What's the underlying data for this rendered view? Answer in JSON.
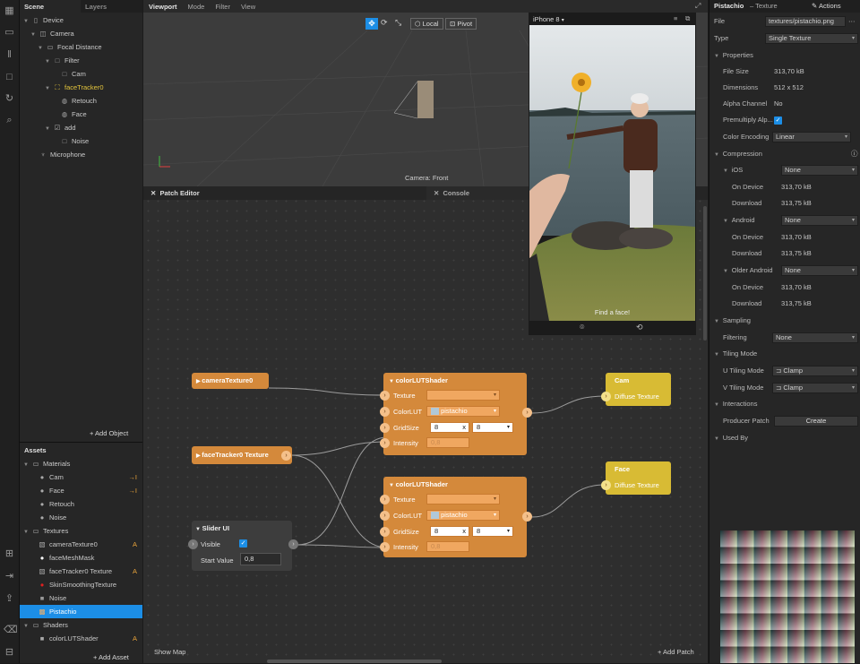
{
  "scene_panel": {
    "tabs": [
      "Scene",
      "Layers"
    ],
    "tree": [
      {
        "label": "Device",
        "icon": "phone-icon"
      },
      {
        "label": "Camera",
        "icon": "camera-icon"
      },
      {
        "label": "Focal Distance",
        "icon": "focal-icon"
      },
      {
        "label": "Filter",
        "icon": "square-icon"
      },
      {
        "label": "Cam",
        "icon": "square-icon"
      },
      {
        "label": "faceTracker0",
        "icon": "face-tracker-icon"
      },
      {
        "label": "Retouch",
        "icon": "sphere-icon"
      },
      {
        "label": "Face",
        "icon": "sphere-icon"
      },
      {
        "label": "add",
        "icon": "square-icon"
      },
      {
        "label": "Noise",
        "icon": "square-icon"
      },
      {
        "label": "Microphone",
        "icon": "microphone-icon"
      }
    ],
    "add_object": "+ Add Object"
  },
  "assets_panel": {
    "title": "Assets",
    "items": [
      {
        "label": "Materials",
        "icon": "folder-icon",
        "badge": ""
      },
      {
        "label": "Cam",
        "icon": "material-icon",
        "badge": "→I"
      },
      {
        "label": "Face",
        "icon": "material-icon",
        "badge": "→I"
      },
      {
        "label": "Retouch",
        "icon": "material-icon",
        "badge": ""
      },
      {
        "label": "Noise",
        "icon": "material-icon",
        "badge": ""
      },
      {
        "label": "Textures",
        "icon": "folder-icon",
        "badge": ""
      },
      {
        "label": "cameraTexture0",
        "icon": "texture-icon",
        "badge": "A"
      },
      {
        "label": "faceMeshMask",
        "icon": "white-circle-icon",
        "badge": ""
      },
      {
        "label": "faceTracker0 Texture",
        "icon": "texture-icon",
        "badge": "A"
      },
      {
        "label": "SkinSmoothingTexture",
        "icon": "red-circle-icon",
        "badge": ""
      },
      {
        "label": "Noise",
        "icon": "gray-square-icon",
        "badge": ""
      },
      {
        "label": "Pistachio",
        "icon": "image-thumb-icon",
        "badge": ""
      },
      {
        "label": "Shaders",
        "icon": "folder-icon",
        "badge": ""
      },
      {
        "label": "colorLUTShader",
        "icon": "shader-icon",
        "badge": "A"
      }
    ],
    "add_asset": "+ Add Asset"
  },
  "viewport": {
    "menu": [
      "Viewport",
      "Mode",
      "Filter",
      "View"
    ],
    "tools": {
      "local": "Local",
      "pivot": "Pivot"
    },
    "camera_label": "Camera: Front"
  },
  "patch_editor": {
    "tab": "Patch Editor",
    "console_tab": "Console",
    "nodes": {
      "camera_texture": "cameraTexture0",
      "face_tracker_texture": "faceTracker0 Texture",
      "shader1": {
        "title": "colorLUTShader",
        "texture": "Texture",
        "colorlut": "ColorLUT",
        "colorlut_value": "pistachio",
        "gridsize": "GridSize",
        "grid_x": "8",
        "grid_y": "8",
        "x_sep": "x",
        "intensity": "Intensity",
        "intensity_value": "0,8"
      },
      "shader2": {
        "title": "colorLUTShader",
        "texture": "Texture",
        "colorlut": "ColorLUT",
        "colorlut_value": "pistachio",
        "gridsize": "GridSize",
        "grid_x": "8",
        "grid_y": "8",
        "x_sep": "x",
        "intensity": "Intensity",
        "intensity_value": "0,8"
      },
      "cam_output": {
        "title": "Cam",
        "port": "Diffuse Texture"
      },
      "face_output": {
        "title": "Face",
        "port": "Diffuse Texture"
      },
      "slider": {
        "title": "Slider UI",
        "visible": "Visible",
        "start_value_label": "Start Value",
        "start_value": "0,8"
      }
    },
    "show_map": "Show Map",
    "add_patch": "+ Add Patch"
  },
  "phone_preview": {
    "device": "iPhone 8",
    "overlay_text": "Find a face!"
  },
  "inspector": {
    "title": "Pistachio",
    "subtitle": "– Texture",
    "actions": "Actions",
    "file_label": "File",
    "file_value": "textures/pistachio.png",
    "type_label": "Type",
    "type_value": "Single Texture",
    "properties": "Properties",
    "file_size_label": "File Size",
    "file_size": "313,70 kB",
    "dimensions_label": "Dimensions",
    "dimensions": "512 x 512",
    "alpha_label": "Alpha Channel",
    "alpha": "No",
    "premultiply_label": "Premultiply Alp...",
    "color_encoding_label": "Color Encoding",
    "color_encoding": "Linear",
    "compression": "Compression",
    "ios": "iOS",
    "android": "Android",
    "older_android": "Older Android",
    "none": "None",
    "on_device_label": "On Device",
    "download_label": "Download",
    "ios_on_device": "313,70 kB",
    "ios_download": "313,75 kB",
    "android_on_device": "313,70 kB",
    "android_download": "313,75 kB",
    "older_on_device": "313,70 kB",
    "older_download": "313,75 kB",
    "sampling": "Sampling",
    "filtering_label": "Filtering",
    "filtering": "None",
    "tiling_mode": "Tiling Mode",
    "u_tiling_label": "U Tiling Mode",
    "v_tiling_label": "V Tiling Mode",
    "clamp": "Clamp",
    "interactions": "Interactions",
    "producer_patch_label": "Producer Patch",
    "create": "Create",
    "used_by": "Used By"
  },
  "colors": {
    "accent": "#1c8ee6",
    "patch_node": "#d4893b",
    "output_node": "#d8bb34"
  }
}
